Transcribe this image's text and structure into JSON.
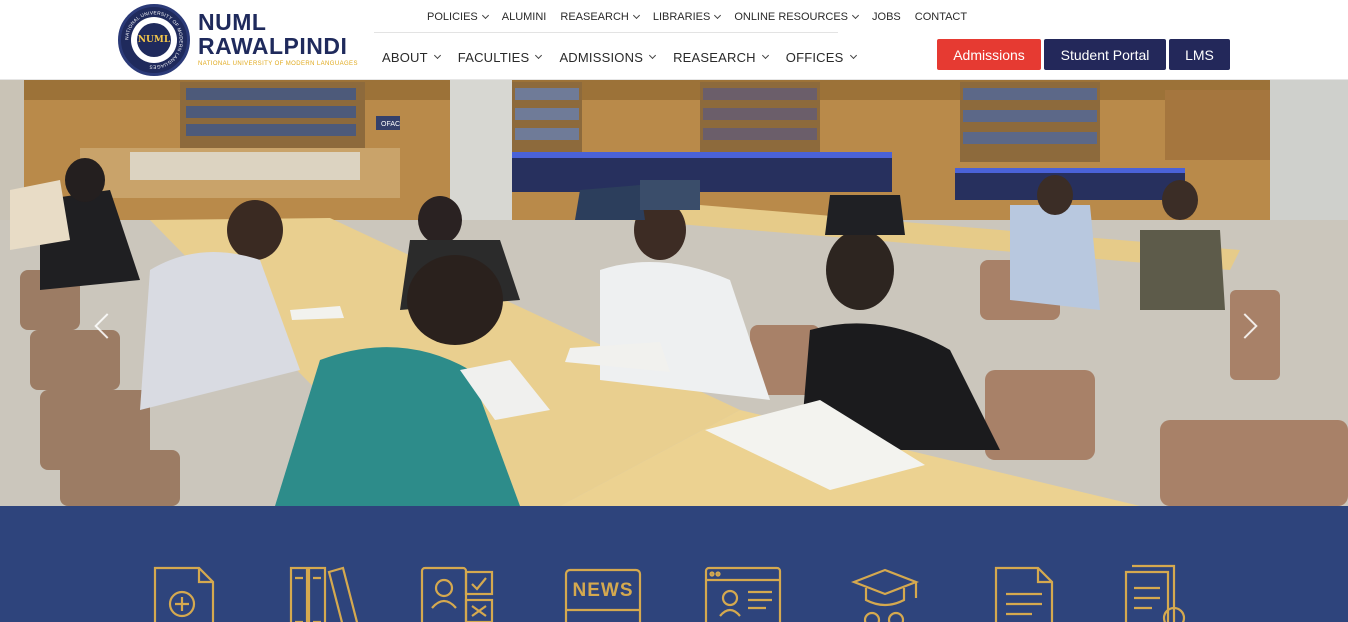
{
  "brand": {
    "line1": "NUML",
    "line2": "RAWALPINDI",
    "tagline": "NATIONAL UNIVERSITY OF MODERN LANGUAGES",
    "seal_text": "NATIONAL UNIVERSITY OF MODERN LANGUAGES",
    "seal_mark": "NUML"
  },
  "top_nav": [
    {
      "label": "POLICIES",
      "dropdown": true
    },
    {
      "label": "ALUMINI",
      "dropdown": false
    },
    {
      "label": "REASEARCH",
      "dropdown": true
    },
    {
      "label": "LIBRARIES",
      "dropdown": true
    },
    {
      "label": "ONLINE RESOURCES",
      "dropdown": true
    },
    {
      "label": "JOBS",
      "dropdown": false
    },
    {
      "label": "CONTACT",
      "dropdown": false
    }
  ],
  "main_nav": [
    {
      "label": "ABOUT"
    },
    {
      "label": "FACULTIES"
    },
    {
      "label": "ADMISSIONS"
    },
    {
      "label": "REASEARCH"
    },
    {
      "label": "OFFICES"
    }
  ],
  "buttons": {
    "admissions": "Admissions",
    "student_portal": "Student Portal",
    "lms": "LMS"
  },
  "hero": {
    "ofac_sign": "OFAC",
    "prev_icon": "chevron-left-icon",
    "next_icon": "chevron-right-icon"
  },
  "quick_links": [
    {
      "icon": "document-add-icon"
    },
    {
      "icon": "books-icon"
    },
    {
      "icon": "profile-check-icon"
    },
    {
      "icon": "news-icon",
      "text": "NEWS"
    },
    {
      "icon": "web-profile-icon"
    },
    {
      "icon": "graduation-cap-icon"
    },
    {
      "icon": "document-text-icon"
    },
    {
      "icon": "document-search-icon"
    }
  ],
  "colors": {
    "navy": "#23285a",
    "red": "#e63a32",
    "band": "#2e447c",
    "gold": "#d5a94f"
  }
}
